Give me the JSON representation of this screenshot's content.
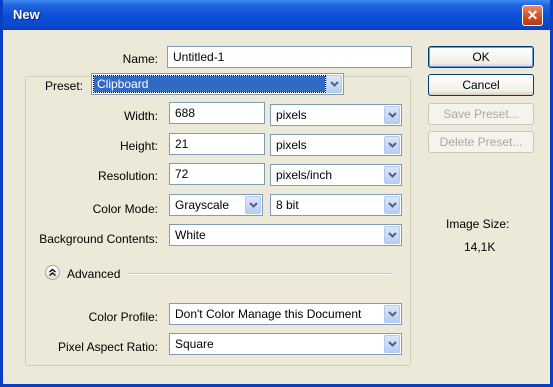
{
  "window": {
    "title": "New",
    "close_glyph": "✕"
  },
  "name": {
    "label": "Name:",
    "value": "Untitled-1"
  },
  "preset": {
    "label": "Preset:",
    "value": "Clipboard"
  },
  "width": {
    "label": "Width:",
    "value": "688",
    "unit": "pixels"
  },
  "height": {
    "label": "Height:",
    "value": "21",
    "unit": "pixels"
  },
  "resolution": {
    "label": "Resolution:",
    "value": "72",
    "unit": "pixels/inch"
  },
  "color_mode": {
    "label": "Color Mode:",
    "value": "Grayscale",
    "depth": "8 bit"
  },
  "background": {
    "label": "Background Contents:",
    "value": "White"
  },
  "advanced": {
    "label": "Advanced",
    "icon": "chevron-up-icon"
  },
  "color_profile": {
    "label": "Color Profile:",
    "value": "Don't Color Manage this Document"
  },
  "pixel_aspect": {
    "label": "Pixel Aspect Ratio:",
    "value": "Square"
  },
  "buttons": {
    "ok": "OK",
    "cancel": "Cancel",
    "save_preset": "Save Preset...",
    "delete_preset": "Delete Preset..."
  },
  "image_size": {
    "label": "Image Size:",
    "value": "14,1K"
  },
  "colors": {
    "title_bar": "#0b4fd6",
    "dialog_bg": "#ece9d8",
    "field_border": "#7f9db9",
    "selection": "#316ac5"
  }
}
